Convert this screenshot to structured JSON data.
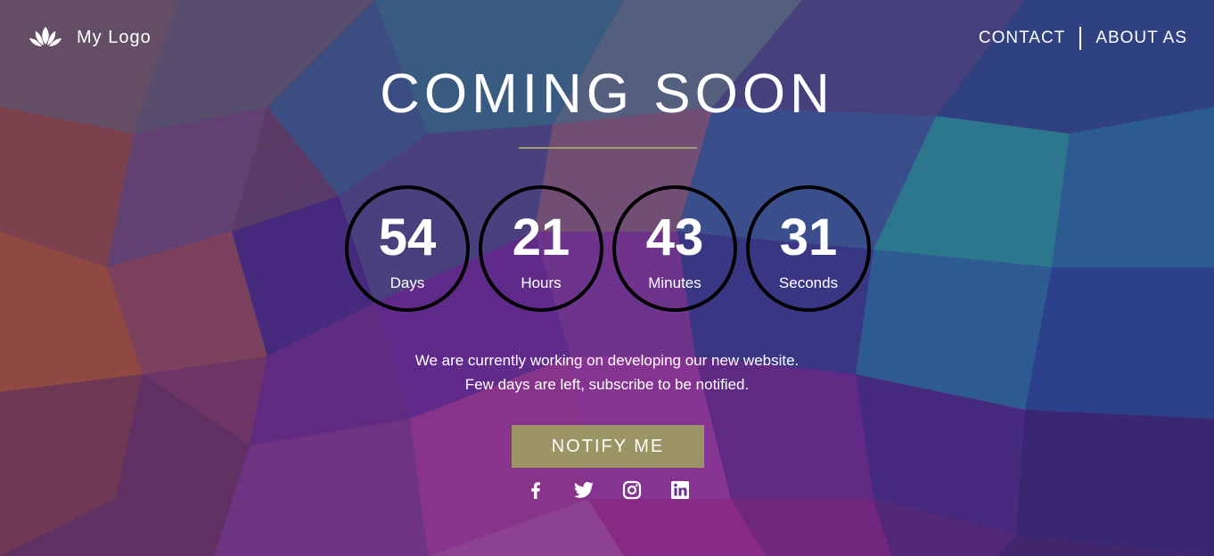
{
  "header": {
    "logo_text": "My Logo",
    "nav": [
      {
        "label": "CONTACT"
      },
      {
        "label": "ABOUT AS"
      }
    ]
  },
  "hero": {
    "title": "COMING SOON",
    "countdown": [
      {
        "value": "54",
        "unit": "Days"
      },
      {
        "value": "21",
        "unit": "Hours"
      },
      {
        "value": "43",
        "unit": "Minutes"
      },
      {
        "value": "31",
        "unit": "Seconds"
      }
    ],
    "message_line1": "We are currently working on developing our new website.",
    "message_line2": "Few days are left, subscribe to be notified.",
    "notify_label": "NOTIFY ME"
  },
  "social": [
    {
      "icon": "facebook-icon"
    },
    {
      "icon": "twitter-icon"
    },
    {
      "icon": "instagram-icon"
    },
    {
      "icon": "linkedin-icon"
    }
  ],
  "colors": {
    "accent": "#9b9464",
    "divider": "#a39d6a",
    "text": "#ffffff",
    "circle_border": "#000000"
  }
}
